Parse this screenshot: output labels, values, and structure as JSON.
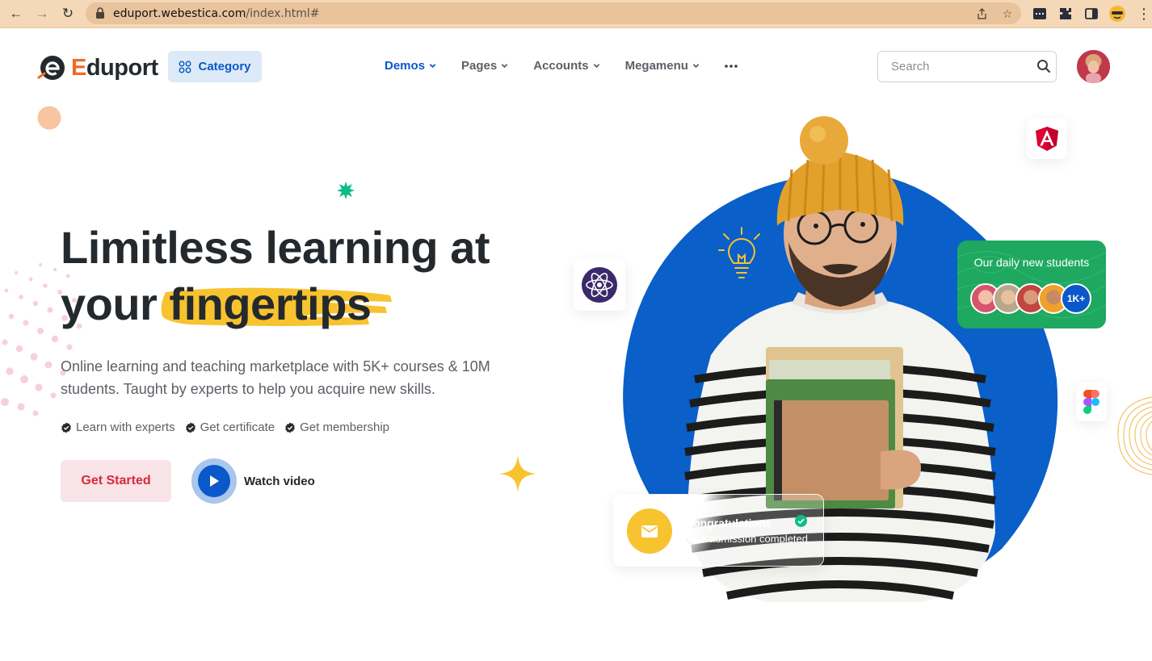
{
  "browser": {
    "url_host": "eduport.webestica.com",
    "url_path": "/index.html#"
  },
  "header": {
    "logo_text": "Eduport",
    "logo_first_letter": "E",
    "logo_rest": "duport",
    "category_label": "Category",
    "nav": [
      {
        "label": "Demos",
        "active": true
      },
      {
        "label": "Pages",
        "active": false
      },
      {
        "label": "Accounts",
        "active": false
      },
      {
        "label": "Megamenu",
        "active": false
      }
    ],
    "more_icon": "ellipsis-icon",
    "search": {
      "placeholder": "Search"
    }
  },
  "hero": {
    "title_line1": "Limitless learning at",
    "title_line2_prefix": "your",
    "title_highlight": "fingertips",
    "description": "Online learning and teaching marketplace with 5K+ courses & 10M students. Taught by experts to help you acquire new skills.",
    "features": [
      "Learn with experts",
      "Get certificate",
      "Get membership"
    ],
    "cta_primary": "Get Started",
    "cta_video": "Watch video"
  },
  "cards": {
    "students_title": "Our daily new students",
    "students_count": "1K+",
    "congrats_title": "Congratulations",
    "congrats_subtitle": "Your admission completed"
  },
  "colors": {
    "primary": "#0a58ca",
    "accent_orange": "#f06a2a",
    "highlight_yellow": "#f7c32e",
    "danger": "#d6293e",
    "success": "#1ea860"
  }
}
